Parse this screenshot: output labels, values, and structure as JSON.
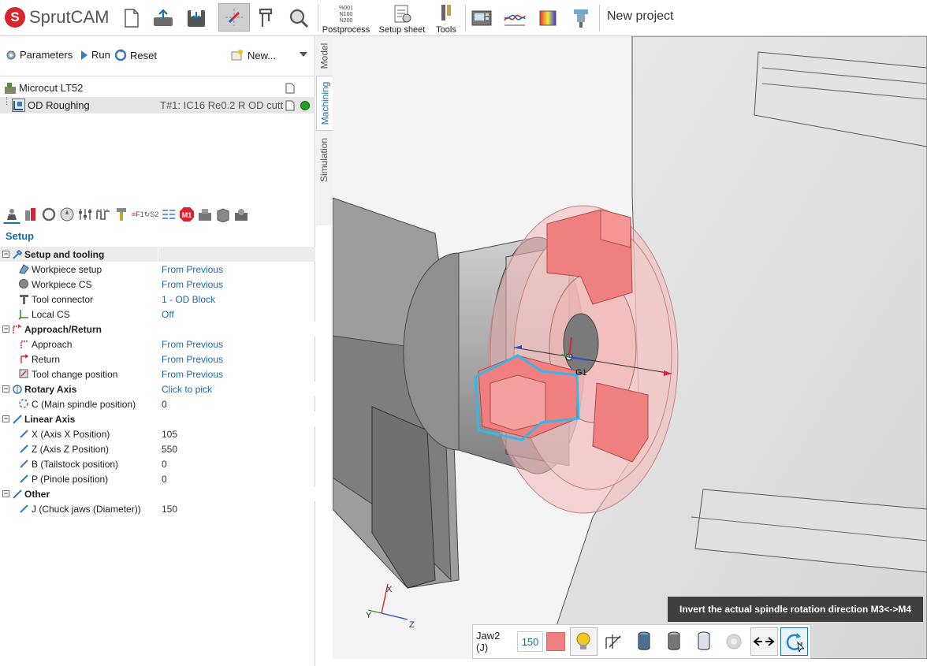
{
  "app": {
    "name": "SprutCAM",
    "project_title": "New project",
    "brand_color": "#d9232d",
    "accent": "#1e6ab0"
  },
  "toolbar": {
    "postprocess_label": "Postprocess",
    "setup_sheet_label": "Setup sheet",
    "tools_label": "Tools",
    "postprocess_icon_text": [
      "%001",
      "N100",
      "N200"
    ]
  },
  "operations": {
    "parameters_label": "Parameters",
    "run_label": "Run",
    "reset_label": "Reset",
    "new_label": "New..."
  },
  "tree": {
    "machine": "Microcut LT52",
    "operation": "OD Roughing",
    "tool_text": "T#1: IC16 Re0.2 R OD cutt",
    "status_color": "#1fa21f"
  },
  "setup": {
    "title": "Setup",
    "groups": [
      {
        "name": "Setup and tooling",
        "items": [
          {
            "name": "Workpiece setup",
            "value": "From Previous"
          },
          {
            "name": "Workpiece CS",
            "value": "From Previous"
          },
          {
            "name": "Tool connector",
            "value": "1 - OD Block"
          },
          {
            "name": "Local CS",
            "value": "Off"
          }
        ]
      },
      {
        "name": "Approach/Return",
        "items": [
          {
            "name": "Approach",
            "value": "From Previous"
          },
          {
            "name": "Return",
            "value": "From Previous"
          },
          {
            "name": "Tool change position",
            "value": "From Previous"
          }
        ]
      },
      {
        "name": "Rotary Axis",
        "value": "Click to pick",
        "items": [
          {
            "name": "C (Main spindle position)",
            "value": "0"
          }
        ]
      },
      {
        "name": "Linear Axis",
        "items": [
          {
            "name": "X (Axis X Position)",
            "value": "105"
          },
          {
            "name": "Z (Axis Z Position)",
            "value": "550"
          },
          {
            "name": "B (Tailstock position)",
            "value": "0"
          },
          {
            "name": "P (Pinole position)",
            "value": "0"
          }
        ]
      },
      {
        "name": "Other",
        "items": [
          {
            "name": "J (Chuck jaws (Diameter))",
            "value": "150"
          }
        ]
      }
    ]
  },
  "tabs": {
    "model": "Model",
    "machining": "Machining",
    "simulation": "Simulation"
  },
  "viewport": {
    "g1_label": "G1",
    "m1_badge": "M1",
    "strip_text_1": "F1",
    "strip_text_2": "S2",
    "axes": {
      "x": "X",
      "y": "Y",
      "z": "Z"
    }
  },
  "jawbar": {
    "label": "Jaw2 (J)",
    "value": "150",
    "jaw_color": "#f08080"
  },
  "tooltip": {
    "text": "Invert the actual spindle rotation direction M3<->M4"
  }
}
